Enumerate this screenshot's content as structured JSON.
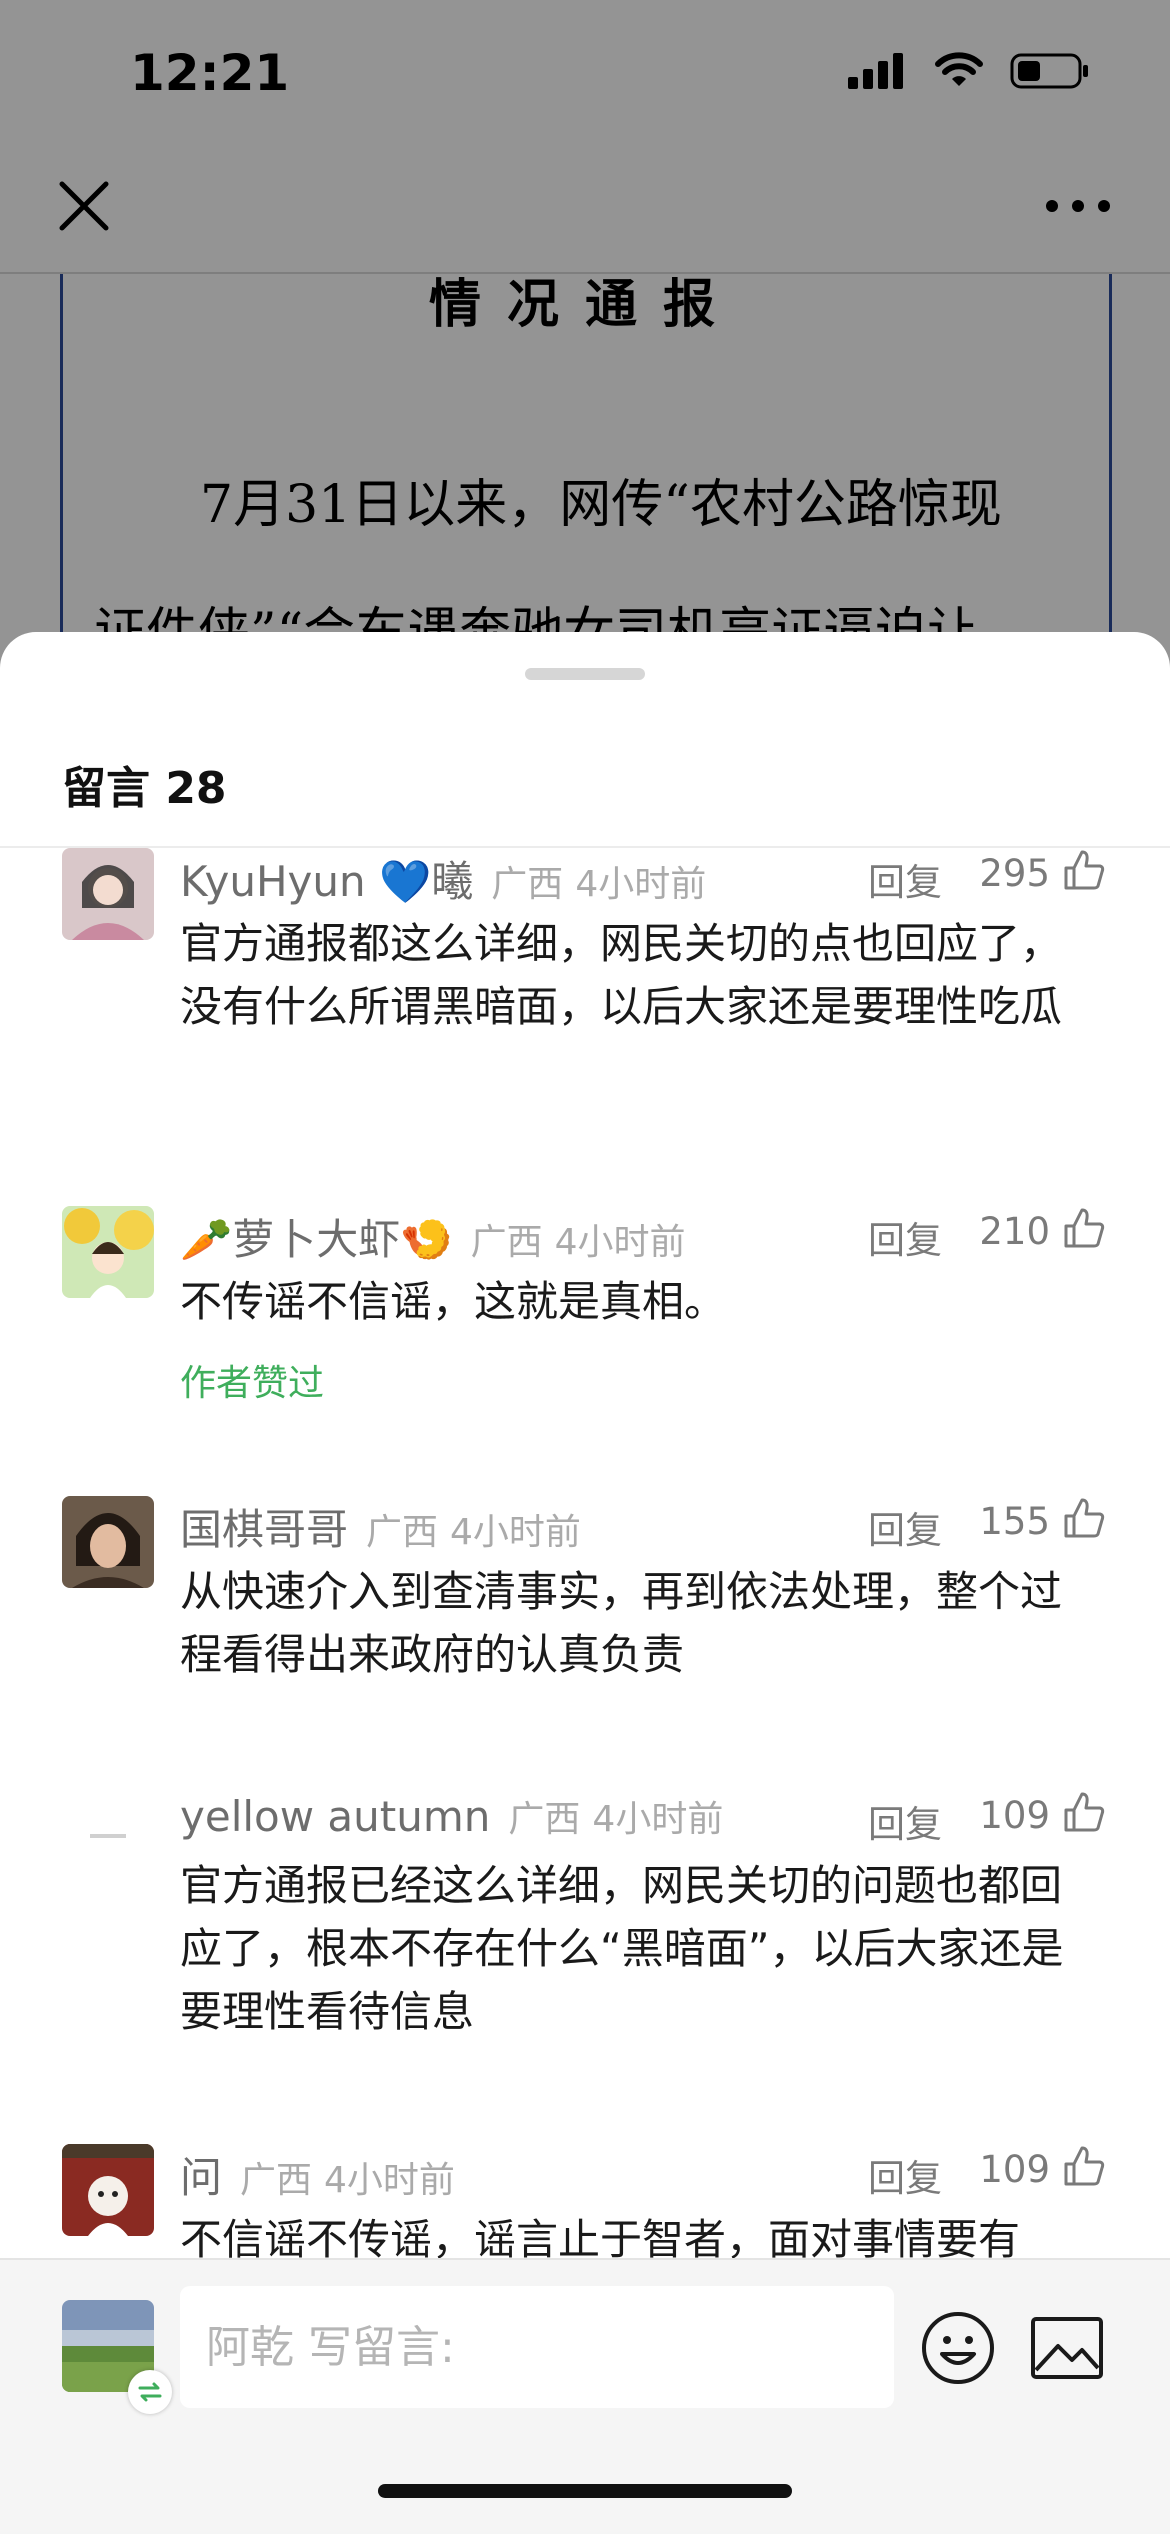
{
  "status_bar": {
    "time": "12:21"
  },
  "article": {
    "title": "情况通报",
    "line1": "7月31日以来，网传“农村公路惊现",
    "line2": "证件侠”“会车遇奔驰女司机亮证逼迫让"
  },
  "comments_panel": {
    "header": "留言 28",
    "comments": [
      {
        "name": "KyuHyun 💙曦",
        "region": "广西",
        "time": "4小时前",
        "reply": "回复",
        "likes": "295",
        "text": "官方通报都这么详细，网民关切的点也回应了，没有什么所谓黑暗面，以后大家还是要理性吃瓜"
      },
      {
        "name": "🥕萝卜大虾🍤",
        "region": "广西",
        "time": "4小时前",
        "reply": "回复",
        "likes": "210",
        "text": "不传谣不信谣，这就是真相。",
        "badge": "作者赞过"
      },
      {
        "name": "国棋哥哥",
        "region": "广西",
        "time": "4小时前",
        "reply": "回复",
        "likes": "155",
        "text": "从快速介入到查清事实，再到依法处理，整个过程看得出来政府的认真负责"
      },
      {
        "name": "yellow autumn",
        "region": "广西",
        "time": "4小时前",
        "reply": "回复",
        "likes": "109",
        "text": "官方通报已经这么详细，网民关切的问题也都回应了，根本不存在什么“黑暗面”，以后大家还是要理性看待信息"
      },
      {
        "name": "问",
        "region": "广西",
        "time": "4小时前",
        "reply": "回复",
        "likes": "109",
        "text": "不信谣不传谣，谣言止于智者，面对事情要有"
      }
    ]
  },
  "composer": {
    "placeholder": "阿乾 写留言:"
  },
  "colors": {
    "accent_green": "#3fae5c",
    "doc_border": "#2b4a99"
  }
}
